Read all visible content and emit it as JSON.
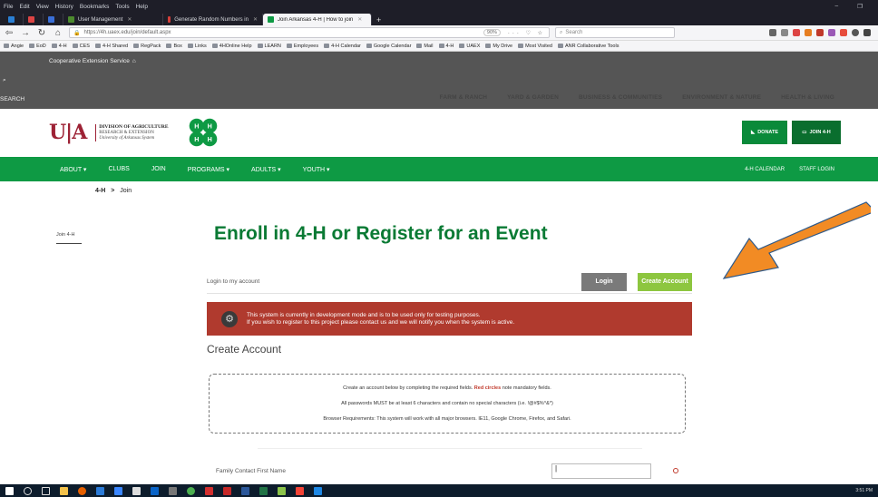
{
  "browser": {
    "menu": [
      "File",
      "Edit",
      "View",
      "History",
      "Bookmarks",
      "Tools",
      "Help"
    ],
    "tabs": [
      {
        "label": "User Management",
        "color": "#4c8a2e"
      },
      {
        "label": "Generate Random Numbers in",
        "color": "#d43f3a"
      },
      {
        "label": "Join Arkansas 4-H | How to join",
        "color": "#0e9a44"
      }
    ],
    "url": "https://4h.uaex.edu/join/default.aspx",
    "zoom": "90%",
    "search_placeholder": "Search",
    "bookmarks": [
      "Angie",
      "EoD",
      "4-H",
      "CES",
      "4-H Shared",
      "RegPack",
      "Box",
      "Links",
      "4HOnline Help",
      "LEARN",
      "Employees",
      "4-H Calendar",
      "Google Calendar",
      "Mail",
      "4-H",
      "UAEX",
      "My Drive",
      "Most Visited",
      "ANR Collaborative Tools"
    ]
  },
  "site": {
    "cooperative": "Cooperative Extension Service",
    "search_btn": "SEARCH",
    "topnav": [
      "FARM & RANCH",
      "YARD & GARDEN",
      "BUSINESS & COMMUNITIES",
      "ENVIRONMENT & NATURE",
      "HEALTH & LIVING"
    ],
    "logo": {
      "ua": "U|A",
      "line1": "DIVISION OF AGRICULTURE",
      "line2": "RESEARCH & EXTENSION",
      "line3": "University of Arkansas System"
    },
    "donate": "DONATE",
    "join": "JOIN 4-H",
    "mainnav": [
      "ABOUT ▾",
      "CLUBS",
      "JOIN",
      "PROGRAMS ▾",
      "ADULTS ▾",
      "YOUTH ▾"
    ],
    "mainnav_right": [
      "4-H CALENDAR",
      "STAFF LOGIN"
    ],
    "breadcrumb_root": "4-H",
    "breadcrumb_sep": ">",
    "breadcrumb_current": "Join",
    "side_link": "Join 4-H",
    "headline": "Enroll in 4-H or Register for an Event",
    "login_label": "Login to my account",
    "login_btn": "Login",
    "create_btn": "Create Account",
    "alert_line1": "This system is currently in development mode and is to be used only for testing purposes.",
    "alert_line2": "If you wish to register to this project please contact us and we will notify you when the system is active.",
    "subhead": "Create Account",
    "info1_a": "Create an account below by completing the required fields.",
    "info1_b": "Red circles",
    "info1_c": "note mandatory fields.",
    "info2": "All passwords MUST be at least 6 characters and contain no special characters (i.e. !@#$%^&*)",
    "info3": "Browser Requirements: This system will work with all major browsers. IE11, Google Chrome, Firefox, and Safari.",
    "field_label": "Family Contact First Name",
    "field_value": "|"
  },
  "taskbar": {
    "clock": "3:51 PM"
  }
}
